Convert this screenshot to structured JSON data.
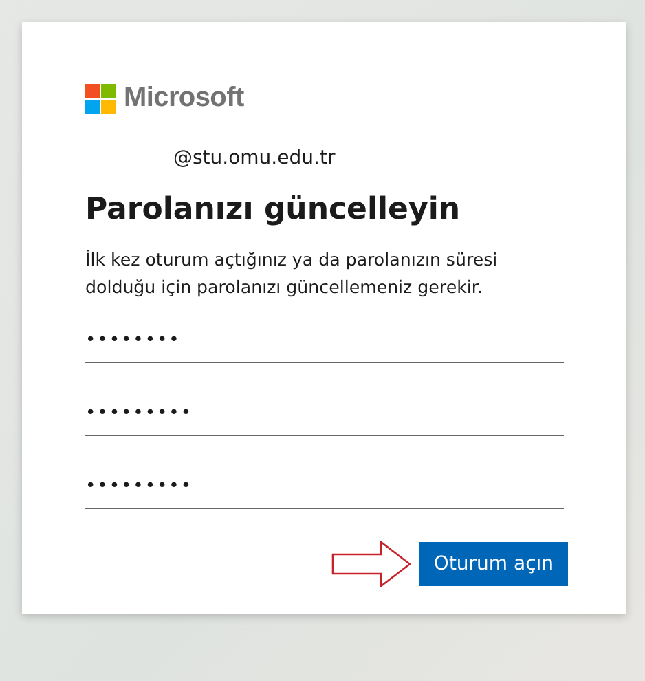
{
  "brand": "Microsoft",
  "account": "@stu.omu.edu.tr",
  "title": "Parolanızı güncelleyin",
  "description": "İlk kez oturum açtığınız ya da parolanızın süresi dolduğu için parolanızı güncellemeniz gerekir.",
  "fields": [
    {
      "value": "••••••••"
    },
    {
      "value": "•••••••••"
    },
    {
      "value": "•••••••••"
    }
  ],
  "button": "Oturum açın"
}
